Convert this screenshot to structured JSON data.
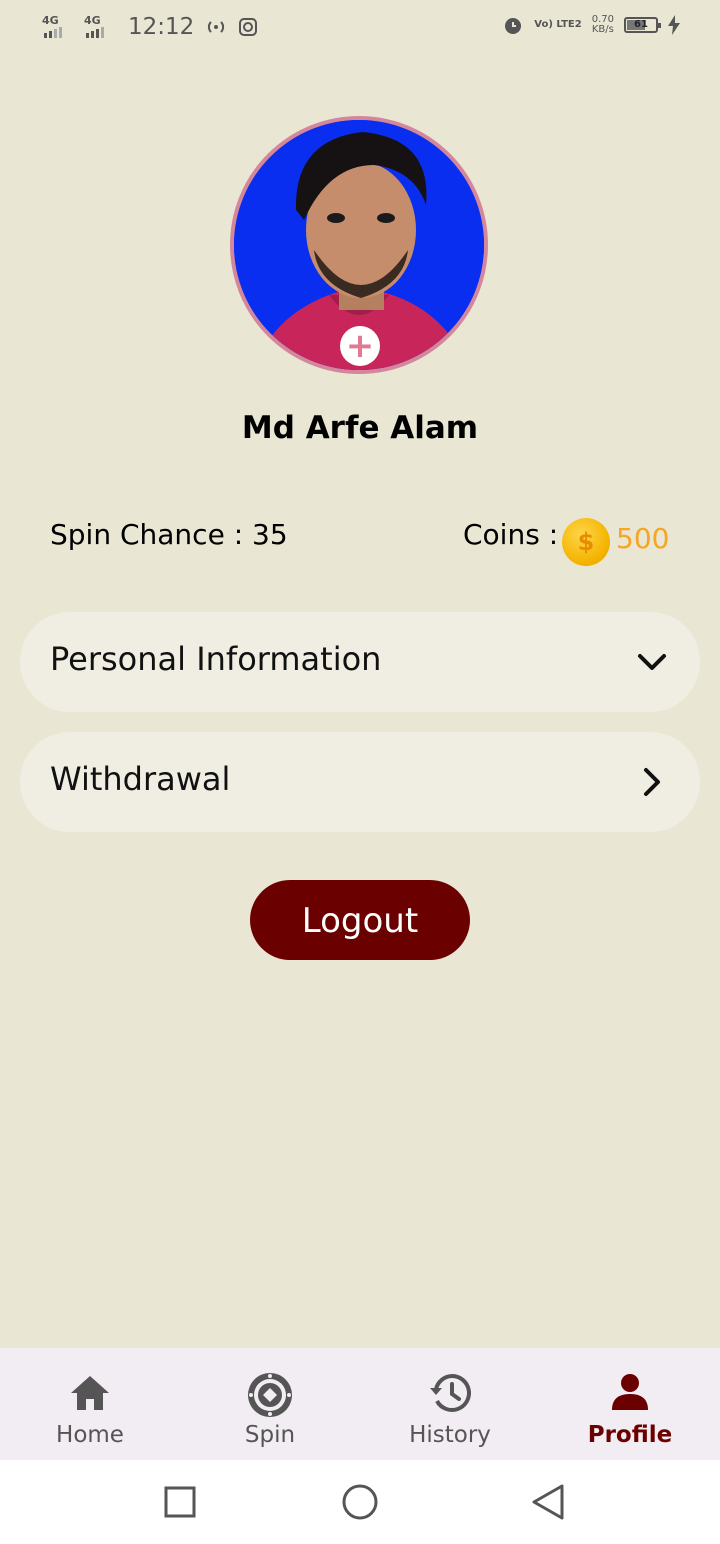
{
  "status_bar": {
    "network1": "4G",
    "network2": "4G",
    "time": "12:12",
    "volte": "Vo) LTE2",
    "speed": "0.70",
    "speed_unit": "KB/s",
    "battery": "61"
  },
  "profile": {
    "name": "Md Arfe Alam",
    "spin_chance_label": "Spin Chance : 35",
    "coins_label": "Coins :",
    "coins_value": "500"
  },
  "menu": [
    {
      "label": "Personal Information",
      "icon": "chevron-down-icon"
    },
    {
      "label": "Withdrawal",
      "icon": "chevron-right-icon"
    }
  ],
  "logout_label": "Logout",
  "bottom_nav": [
    {
      "label": "Home",
      "icon": "home-icon",
      "active": false
    },
    {
      "label": "Spin",
      "icon": "spin-wheel-icon",
      "active": false
    },
    {
      "label": "History",
      "icon": "history-icon",
      "active": false
    },
    {
      "label": "Profile",
      "icon": "profile-icon",
      "active": true
    }
  ],
  "colors": {
    "background": "#e9e6d4",
    "accent": "#6b0000",
    "coins": "#f5a623",
    "avatar_border": "#d4879a"
  }
}
